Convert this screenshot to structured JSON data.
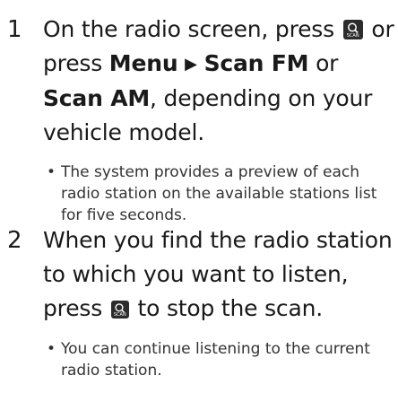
{
  "steps": [
    {
      "number": "1",
      "text_a": "On the radio screen, press ",
      "text_b": " or press ",
      "menu": "Menu",
      "arrow": "▶",
      "scan_fm": "Scan FM",
      "or": " or ",
      "scan_am": "Scan AM",
      "text_c": ", depending on your vehicle model.",
      "icon": "scan-icon",
      "icon_caption": "SCAN",
      "note": "The system provides a preview of each radio station on the available stations list for five seconds."
    },
    {
      "number": "2",
      "text_a": "When you find the radio station to which you want to listen, press ",
      "text_b": " to stop the scan.",
      "icon": "scan-icon",
      "icon_caption": "SCAN",
      "note": "You can continue listening to the current radio station."
    }
  ]
}
